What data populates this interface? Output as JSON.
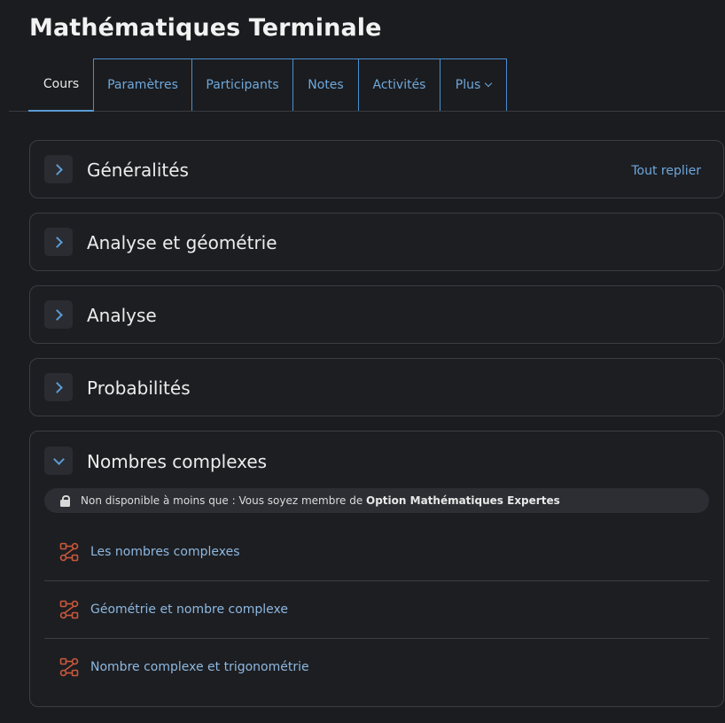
{
  "course": {
    "title": "Mathématiques Terminale"
  },
  "tabs": [
    {
      "label": "Cours",
      "active": true
    },
    {
      "label": "Paramètres",
      "active": false
    },
    {
      "label": "Participants",
      "active": false
    },
    {
      "label": "Notes",
      "active": false
    },
    {
      "label": "Activités",
      "active": false
    },
    {
      "label": "Plus",
      "active": false
    }
  ],
  "collapse_all_label": "Tout replier",
  "sections": [
    {
      "title": "Généralités",
      "expanded": false
    },
    {
      "title": "Analyse et géométrie",
      "expanded": false
    },
    {
      "title": "Analyse",
      "expanded": false
    },
    {
      "title": "Probabilités",
      "expanded": false
    },
    {
      "title": "Nombres complexes",
      "expanded": true
    }
  ],
  "restriction": {
    "prefix": "Non disponible à moins que : Vous soyez membre de ",
    "group": "Option Mathématiques Expertes"
  },
  "activities": [
    {
      "label": "Les nombres complexes",
      "icon": "lesson-flow-icon"
    },
    {
      "label": "Géométrie et nombre complexe",
      "icon": "lesson-flow-icon"
    },
    {
      "label": "Nombre complexe et trigonométrie",
      "icon": "lesson-flow-icon"
    }
  ],
  "colors": {
    "background": "#1b1c1f",
    "accent": "#5b9bd5",
    "link": "#8db8e0",
    "activity_icon": "#c9593a"
  }
}
